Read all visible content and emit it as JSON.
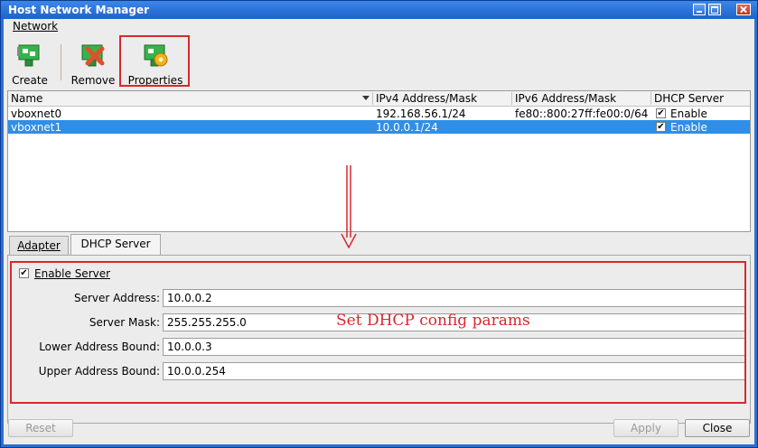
{
  "window": {
    "title": "Host Network Manager"
  },
  "menu": {
    "network": "Network"
  },
  "toolbar": {
    "create": "Create",
    "remove": "Remove",
    "properties": "Properties"
  },
  "table": {
    "columns": [
      "Name",
      "IPv4 Address/Mask",
      "IPv6 Address/Mask",
      "DHCP Server"
    ],
    "rows": [
      {
        "name": "vboxnet0",
        "ipv4": "192.168.56.1/24",
        "ipv6": "fe80::800:27ff:fe00:0/64",
        "dhcp": "Enable",
        "dhcp_checked": true,
        "selected": false
      },
      {
        "name": "vboxnet1",
        "ipv4": "10.0.0.1/24",
        "ipv6": "",
        "dhcp": "Enable",
        "dhcp_checked": true,
        "selected": true
      }
    ]
  },
  "tabs": {
    "adapter": "Adapter",
    "dhcp": "DHCP Server",
    "active": "dhcp"
  },
  "dhcp": {
    "enable_label": "Enable Server",
    "enabled": true,
    "server_address_label": "Server Address:",
    "server_address": "10.0.0.2",
    "server_mask_label": "Server Mask:",
    "server_mask": "255.255.255.0",
    "lower_bound_label": "Lower Address Bound:",
    "lower_bound": "10.0.0.3",
    "upper_bound_label": "Upper Address Bound:",
    "upper_bound": "10.0.0.254"
  },
  "annotation": "Set DHCP config params",
  "buttons": {
    "reset": "Reset",
    "apply": "Apply",
    "close": "Close"
  },
  "colors": {
    "highlight": "#d8282e",
    "selection": "#2f8ee7",
    "titlebar": "#2a6fd1"
  }
}
